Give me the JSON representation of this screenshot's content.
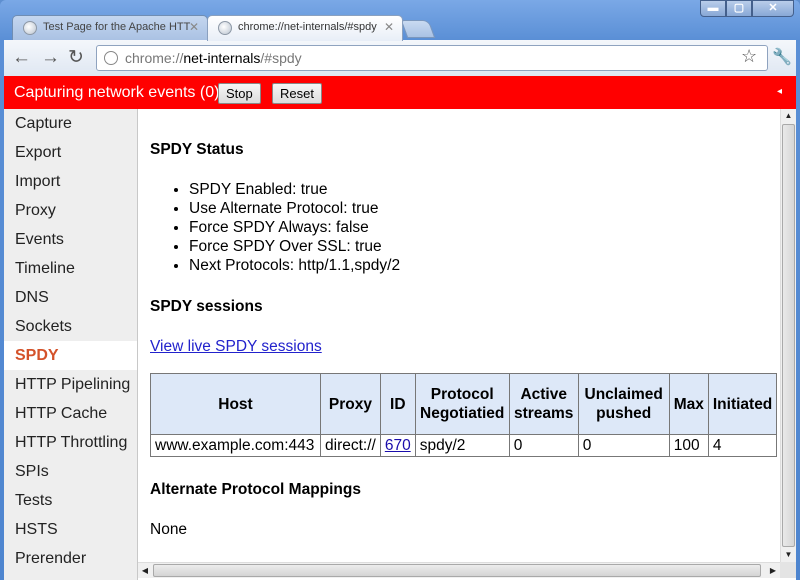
{
  "window": {
    "minimize_glyph": "▬",
    "maximize_glyph": "▢",
    "close_glyph": "✕"
  },
  "tabs": [
    {
      "title": "Test Page for the Apache HTT",
      "active": false,
      "favicon_icon": "globe-icon",
      "close_glyph": "✕"
    },
    {
      "title": "chrome://net-internals/#spdy",
      "active": true,
      "favicon_icon": "globe-icon",
      "close_glyph": "✕"
    }
  ],
  "toolbar": {
    "back_glyph": "←",
    "forward_glyph": "→",
    "reload_glyph": "↻",
    "url_scheme": "chrome://",
    "url_host": "net-internals",
    "url_path": "/#spdy",
    "star_glyph": "☆",
    "wrench_glyph": "🔧"
  },
  "status": {
    "text": "Capturing network events (0)",
    "stop_label": "Stop",
    "reset_label": "Reset",
    "collapse_glyph": "◂",
    "bar_color": "#ff0000"
  },
  "sidebar": {
    "items": [
      "Capture",
      "Export",
      "Import",
      "Proxy",
      "Events",
      "Timeline",
      "DNS",
      "Sockets",
      "SPDY",
      "HTTP Pipelining",
      "HTTP Cache",
      "HTTP Throttling",
      "SPIs",
      "Tests",
      "HSTS",
      "Prerender"
    ],
    "selected": "SPDY",
    "selected_color": "#d4522a"
  },
  "main": {
    "status_heading": "SPDY Status",
    "status_items": [
      "SPDY Enabled: true",
      "Use Alternate Protocol: true",
      "Force SPDY Always: false",
      "Force SPDY Over SSL: true",
      "Next Protocols: http/1.1,spdy/2"
    ],
    "sessions_heading": "SPDY sessions",
    "live_link": "View live SPDY sessions",
    "table": {
      "headers": [
        "Host",
        "Proxy",
        "ID",
        "Protocol Negotiatied",
        "Active streams",
        "Unclaimed pushed",
        "Max",
        "Initiated"
      ],
      "rows": [
        [
          "www.example.com:443",
          "direct://",
          "670",
          "spdy/2",
          "0",
          "0",
          "100",
          "4"
        ]
      ]
    },
    "mappings_heading": "Alternate Protocol Mappings",
    "mappings_value": "None"
  },
  "scrollbars": {
    "up_glyph": "▲",
    "down_glyph": "▼",
    "left_glyph": "◀",
    "right_glyph": "▶"
  }
}
